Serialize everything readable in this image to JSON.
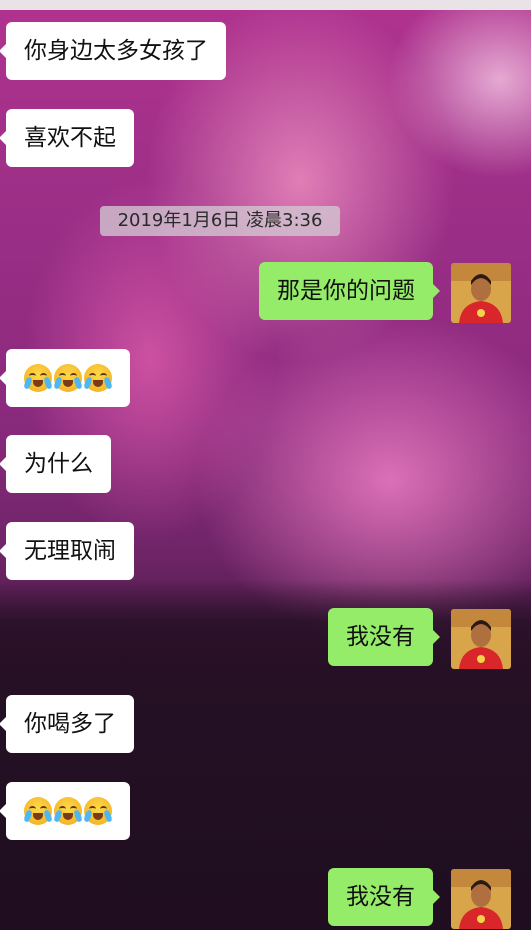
{
  "messages": [
    {
      "side": "left",
      "text": "你身边太多女孩了"
    },
    {
      "side": "left",
      "text": "喜欢不起"
    },
    {
      "side": "right",
      "text": "那是你的问题"
    },
    {
      "side": "left",
      "emoji": [
        "loudly-crying-face",
        "loudly-crying-face",
        "loudly-crying-face"
      ]
    },
    {
      "side": "left",
      "text": "为什么"
    },
    {
      "side": "left",
      "text": "无理取闹"
    },
    {
      "side": "right",
      "text": "我没有"
    },
    {
      "side": "left",
      "text": "你喝多了"
    },
    {
      "side": "left",
      "emoji": [
        "loudly-crying-face",
        "loudly-crying-face",
        "loudly-crying-face"
      ]
    },
    {
      "side": "right",
      "text": "我没有"
    }
  ],
  "timestamp": "2019年1月6日 凌晨3:36",
  "colors": {
    "incoming_bubble": "#ffffff",
    "outgoing_bubble": "#95ec69",
    "text": "#111111"
  }
}
